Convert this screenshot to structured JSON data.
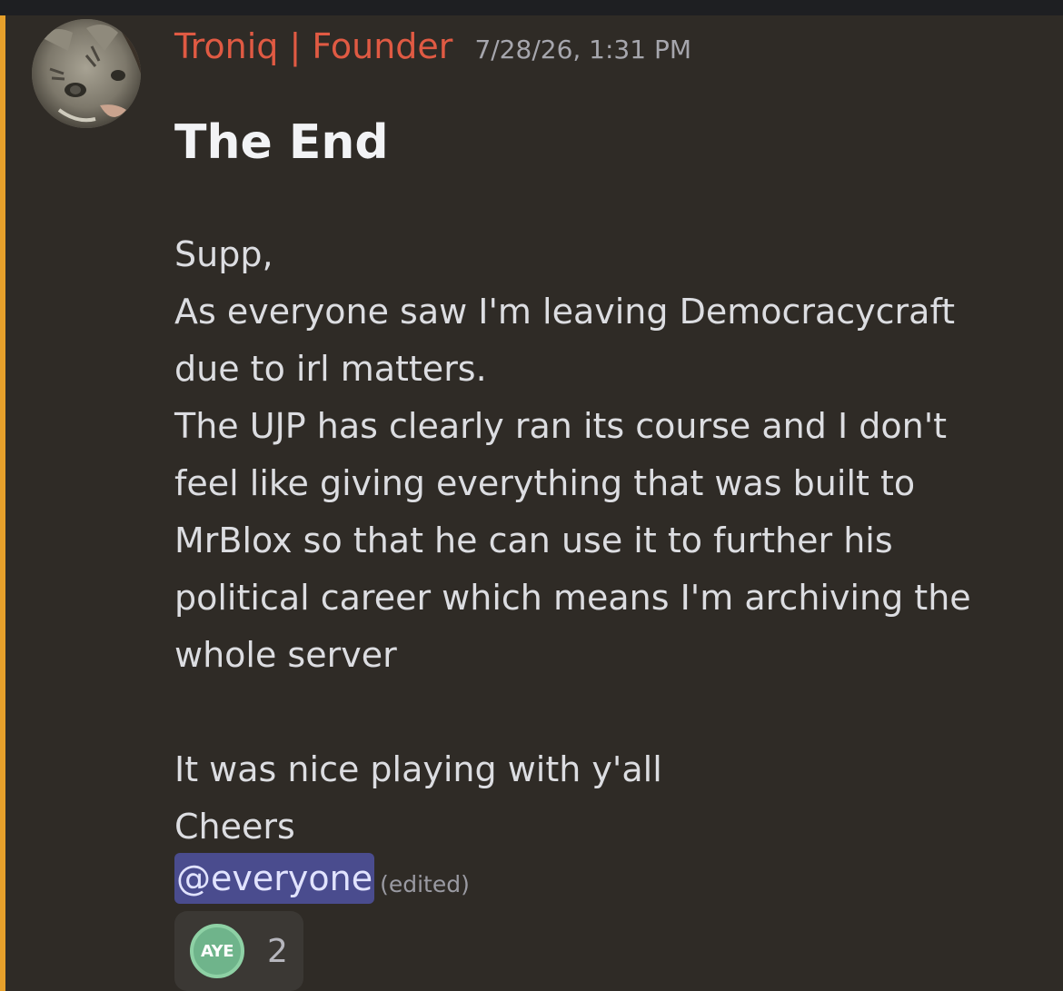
{
  "message": {
    "author": "Troniq | Founder",
    "timestamp": "7/28/26, 1:31 PM",
    "avatar_icon": "cat-avatar-icon",
    "heading": "The End",
    "body_lines": [
      "Supp,",
      "As everyone saw I'm leaving Democracycraft",
      "due to irl matters.",
      "The UJP has clearly ran its course and I don't",
      "feel like giving everything that was built to",
      "MrBlox so that he can use it to further his",
      "political career which means I'm archiving the",
      "whole server",
      "",
      "It was nice playing with y'all",
      "Cheers"
    ],
    "mention": "@everyone",
    "edited_label": "(edited)",
    "reaction": {
      "emoji_text": "AYE",
      "count": "2"
    }
  },
  "colors": {
    "background": "#2f2b26",
    "mention_highlight_bar": "#e6a02b",
    "username": "#e05a43",
    "mention_bg": "#4a4c8e"
  }
}
